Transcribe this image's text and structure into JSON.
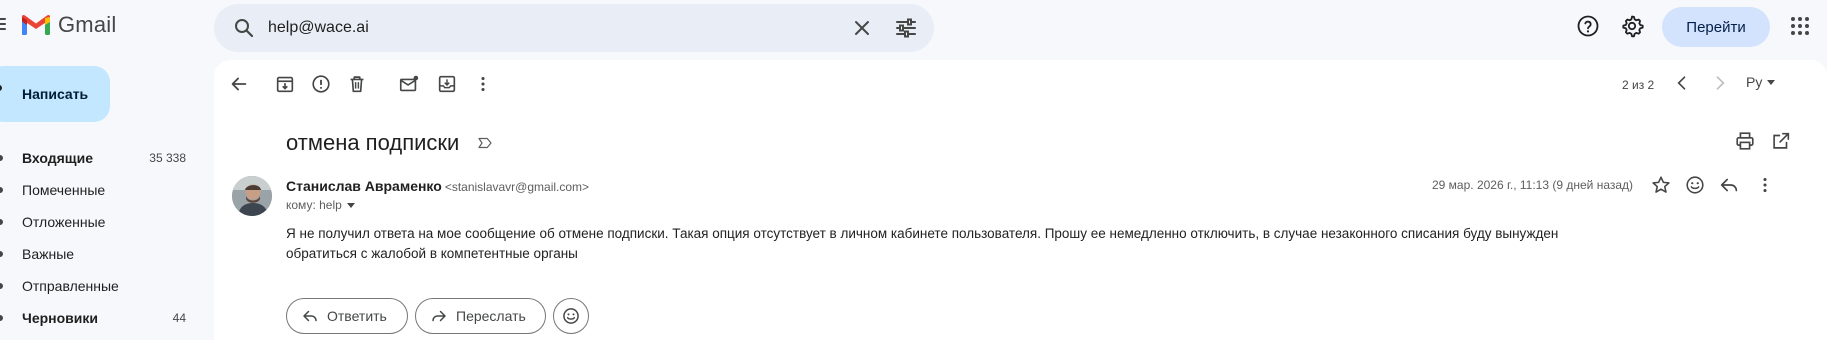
{
  "app": {
    "name": "Gmail"
  },
  "search": {
    "value": "help@wace.ai"
  },
  "header": {
    "go_label": "Перейти"
  },
  "sidebar": {
    "compose_label": "Написать",
    "items": [
      {
        "label": "Входящие",
        "count": "35 338"
      },
      {
        "label": "Помеченные",
        "count": ""
      },
      {
        "label": "Отложенные",
        "count": ""
      },
      {
        "label": "Важные",
        "count": ""
      },
      {
        "label": "Отправленные",
        "count": ""
      },
      {
        "label": "Черновики",
        "count": "44"
      }
    ]
  },
  "toolbar": {
    "pager": "2 из 2",
    "language": "Ру"
  },
  "email": {
    "subject": "отмена подписки",
    "sender_name": "Станислав Авраменко",
    "sender_email": "<stanislavavr@gmail.com>",
    "to": "кому: help",
    "date": "29 мар. 2026 г., 11:13 (9 дней назад)",
    "body": "Я не получил ответа на мое сообщение об отмене подписки. Такая опция отсутствует в личном кабинете пользователя. Прошу ее немедленно отключить, в случае незаконного списания буду вынужден обратиться с жалобой в компетентные органы"
  },
  "actions": {
    "reply_label": "Ответить",
    "forward_label": "Переслать"
  },
  "colors": {
    "compose_bg": "#c2e7ff",
    "search_bg": "#e9eef6",
    "go_button_bg": "#d3e3fd",
    "page_bg": "#f6f8fc"
  }
}
